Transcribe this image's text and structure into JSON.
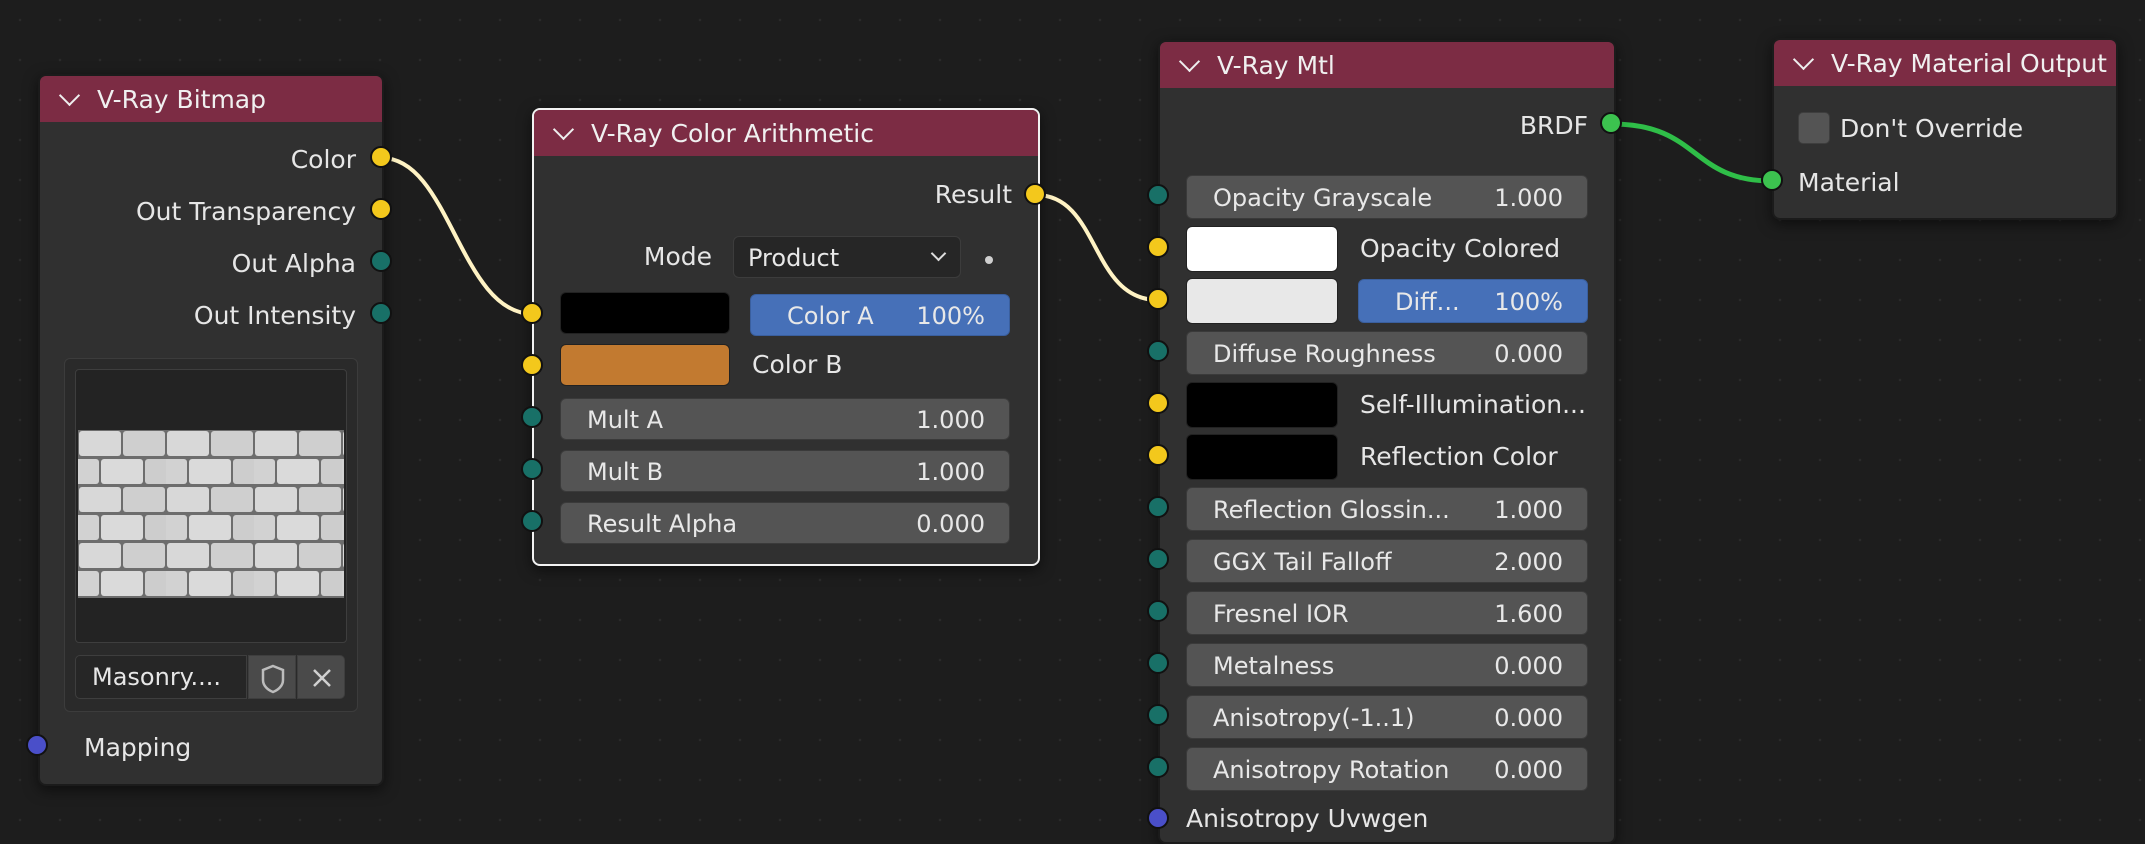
{
  "bitmap": {
    "title": "V-Ray Bitmap",
    "outputs": [
      "Color",
      "Out Transparency",
      "Out Alpha",
      "Out Intensity"
    ],
    "image_name": "Masonry....",
    "mapping_label": "Mapping"
  },
  "arith": {
    "title": "V-Ray Color Arithmetic",
    "result_label": "Result",
    "mode_label": "Mode",
    "mode_value": "Product",
    "color_a_label": "Color A",
    "color_a_value": "100%",
    "color_b_label": "Color B",
    "color_a_swatch": "#000000",
    "color_b_swatch": "#c27a30",
    "mult_a_label": "Mult A",
    "mult_a_value": "1.000",
    "mult_b_label": "Mult B",
    "mult_b_value": "1.000",
    "result_alpha_label": "Result Alpha",
    "result_alpha_value": "0.000"
  },
  "mtl": {
    "title": "V-Ray Mtl",
    "brdf_label": "BRDF",
    "opacity_grayscale_label": "Opacity Grayscale",
    "opacity_grayscale_value": "1.000",
    "opacity_colored_label": "Opacity Colored",
    "diffuse_label": "Diff...",
    "diffuse_value": "100%",
    "diffuse_roughness_label": "Diffuse Roughness",
    "diffuse_roughness_value": "0.000",
    "self_illum_label": "Self-Illumination...",
    "reflection_color_label": "Reflection Color",
    "refl_gloss_label": "Reflection Glossin...",
    "refl_gloss_value": "1.000",
    "ggx_label": "GGX Tail Falloff",
    "ggx_value": "2.000",
    "fresnel_label": "Fresnel IOR",
    "fresnel_value": "1.600",
    "metalness_label": "Metalness",
    "metalness_value": "0.000",
    "aniso_label": "Anisotropy(-1..1)",
    "aniso_value": "0.000",
    "aniso_rot_label": "Anisotropy Rotation",
    "aniso_rot_value": "0.000",
    "aniso_uvw_label": "Anisotropy Uvwgen"
  },
  "output": {
    "title": "V-Ray Material Output",
    "dont_override_label": "Don't Override",
    "material_label": "Material"
  },
  "colors": {
    "header": "#7c2c44",
    "socket_color": "#f3c81c",
    "socket_float": "#187067",
    "socket_vector": "#4a4fc9",
    "socket_brdf": "#3cc24f",
    "field_active": "#4670b8"
  }
}
